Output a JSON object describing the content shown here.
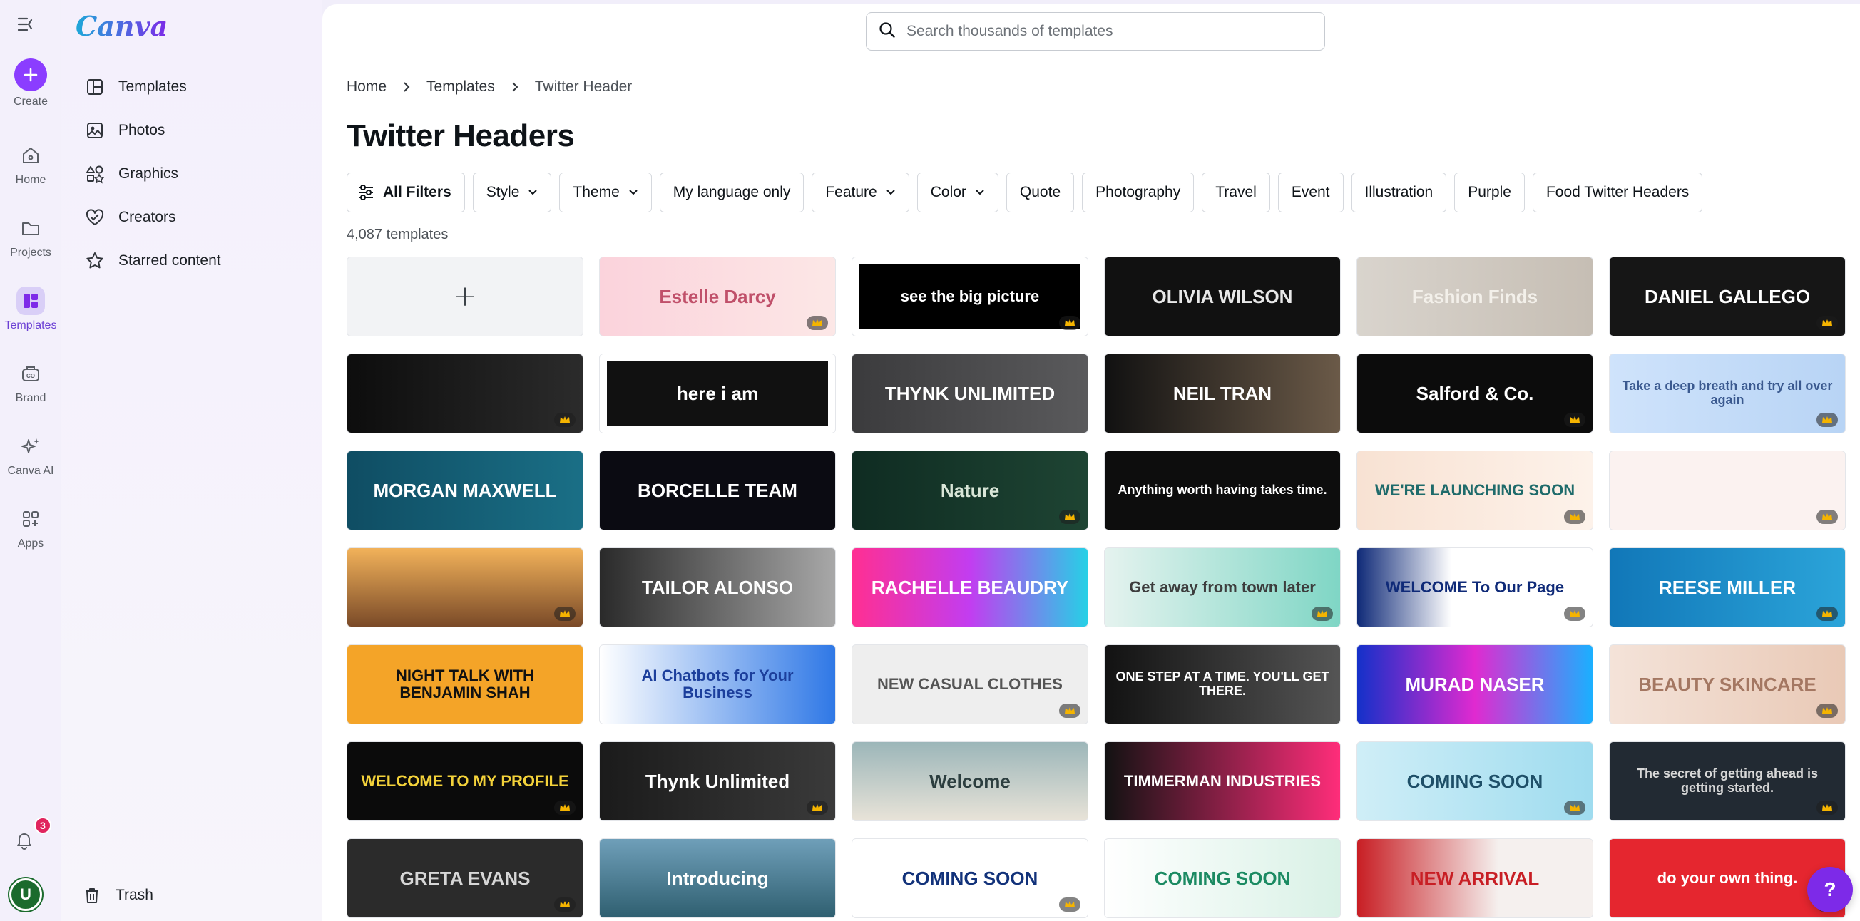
{
  "rail": {
    "items": [
      {
        "label": "Create"
      },
      {
        "label": "Home"
      },
      {
        "label": "Projects"
      },
      {
        "label": "Templates"
      },
      {
        "label": "Brand"
      },
      {
        "label": "Canva AI"
      },
      {
        "label": "Apps"
      }
    ],
    "notification_count": "3",
    "avatar_initial": "U"
  },
  "panel": {
    "logo": "Canva",
    "items": [
      {
        "label": "Templates",
        "icon": "templates-icon"
      },
      {
        "label": "Photos",
        "icon": "photos-icon"
      },
      {
        "label": "Graphics",
        "icon": "graphics-icon"
      },
      {
        "label": "Creators",
        "icon": "creators-icon"
      },
      {
        "label": "Starred content",
        "icon": "star-icon"
      }
    ],
    "trash_label": "Trash"
  },
  "search": {
    "placeholder": "Search thousands of templates"
  },
  "breadcrumb": [
    "Home",
    "Templates",
    "Twitter Header"
  ],
  "page_title": "Twitter Headers",
  "filters": [
    {
      "label": "All Filters"
    },
    {
      "label": "Style"
    },
    {
      "label": "Theme"
    },
    {
      "label": "My language only"
    },
    {
      "label": "Feature"
    },
    {
      "label": "Color"
    },
    {
      "label": "Quote"
    },
    {
      "label": "Photography"
    },
    {
      "label": "Travel"
    },
    {
      "label": "Event"
    },
    {
      "label": "Illustration"
    },
    {
      "label": "Purple"
    },
    {
      "label": "Food Twitter Headers"
    }
  ],
  "count": "4,087 templates",
  "colors": {
    "accent": "#8b3dff",
    "crown": "#f5b400",
    "badge": "#e0245e"
  },
  "templates": [
    {
      "text": "+"
    },
    {
      "text": "Estelle Darcy",
      "bg": "linear-gradient(90deg,#fbd3dc,#fce7e6)",
      "fg": "#c0506a"
    },
    {
      "text": "see the big picture",
      "bg": "#ffffff",
      "fg": "#ffffff",
      "inner": "#000"
    },
    {
      "text": "OLIVIA WILSON",
      "bg": "#111111",
      "fg": "#e8e8e8"
    },
    {
      "text": "Fashion Finds",
      "bg": "linear-gradient(90deg,#d9d4cd,#c6beb4)",
      "fg": "#f3f0ea"
    },
    {
      "text": "DANIEL GALLEGO",
      "bg": "#161616",
      "fg": "#ffffff"
    },
    {
      "text": "",
      "bg": "linear-gradient(90deg,#0d0d0d,#2b2b2b)",
      "fg": "#ddd"
    },
    {
      "text": "here i am",
      "bg": "#ffffff",
      "fg": "#ffffff",
      "inner": "#111"
    },
    {
      "text": "THYNK UNLIMITED",
      "bg": "linear-gradient(90deg,#3b3b3d,#5a5a5c)",
      "fg": "#ffffff"
    },
    {
      "text": "NEIL TRAN",
      "bg": "linear-gradient(90deg,#111,#6b5a48)",
      "fg": "#ffffff"
    },
    {
      "text": "Salford & Co.",
      "bg": "#0c0c0c",
      "fg": "#ffffff"
    },
    {
      "text": "Take a deep breath and try all over again",
      "bg": "linear-gradient(90deg,#cfe3fb,#b8d4f5)",
      "fg": "#3b5a90"
    },
    {
      "text": "MORGAN MAXWELL",
      "bg": "linear-gradient(90deg,#0f4d63,#1a6f86)",
      "fg": "#ffffff"
    },
    {
      "text": "BORCELLE TEAM",
      "bg": "#0b0b12",
      "fg": "#ffffff"
    },
    {
      "text": "Nature",
      "bg": "linear-gradient(90deg,#0f2c22,#1e4433)",
      "fg": "#d9e6d8"
    },
    {
      "text": "Anything worth having takes time.",
      "bg": "#0d0d0d",
      "fg": "#ffffff"
    },
    {
      "text": "WE'RE LAUNCHING SOON",
      "bg": "linear-gradient(90deg,#f8e2d3,#fdf2ea)",
      "fg": "#1f6b6b"
    },
    {
      "text": "",
      "bg": "#fbf2f0",
      "fg": "#b25"
    },
    {
      "text": "",
      "bg": "linear-gradient(180deg,#f2b25a,#7a4a28)",
      "fg": "#fff"
    },
    {
      "text": "TAILOR ALONSO",
      "bg": "linear-gradient(90deg,#2a2a2a,#a8a8a8)",
      "fg": "#ffffff"
    },
    {
      "text": "RACHELLE BEAUDRY",
      "bg": "linear-gradient(90deg,#ff2f92,#c23df0,#26d0e6)",
      "fg": "#ffffff"
    },
    {
      "text": "Get away from town later",
      "bg": "linear-gradient(90deg,#e5f3ef,#7fd6c5)",
      "fg": "#3d3d3d"
    },
    {
      "text": "WELCOME To Our Page",
      "bg": "linear-gradient(90deg,#0f2a78,#ffffff 40%)",
      "fg": "#0f2a78"
    },
    {
      "text": "REESE MILLER",
      "bg": "linear-gradient(90deg,#1177b8,#2ba4d9)",
      "fg": "#ffffff"
    },
    {
      "text": "NIGHT TALK WITH BENJAMIN SHAH",
      "bg": "#f4a428",
      "fg": "#111111"
    },
    {
      "text": "AI Chatbots for Your Business",
      "bg": "linear-gradient(90deg,#ffffff,#2f78e6)",
      "fg": "#1c3f9c"
    },
    {
      "text": "NEW CASUAL CLOTHES",
      "bg": "#eeeeee",
      "fg": "#555555"
    },
    {
      "text": "ONE STEP AT A TIME. YOU'LL GET THERE.",
      "bg": "linear-gradient(90deg,#121212,#555555)",
      "fg": "#ffffff"
    },
    {
      "text": "MURAD NASER",
      "bg": "linear-gradient(90deg,#1430c9,#e02ad0,#1ab0ff)",
      "fg": "#ffffff"
    },
    {
      "text": "BEAUTY SKINCARE",
      "bg": "linear-gradient(90deg,#f4e3d9,#e9c9b6)",
      "fg": "#a47762"
    },
    {
      "text": "WELCOME TO MY PROFILE",
      "bg": "#0b0b0b",
      "fg": "#f3d23a"
    },
    {
      "text": "Thynk Unlimited",
      "bg": "linear-gradient(90deg,#1b1b1b,#3a3a3a)",
      "fg": "#ffffff"
    },
    {
      "text": "Welcome",
      "bg": "linear-gradient(180deg,#9cb6b9,#e8e3d8)",
      "fg": "#2c3e3f"
    },
    {
      "text": "TIMMERMAN INDUSTRIES",
      "bg": "linear-gradient(90deg,#121212,#ff2d7a)",
      "fg": "#ffffff"
    },
    {
      "text": "COMING SOON",
      "bg": "linear-gradient(90deg,#cfeef7,#9fdcef)",
      "fg": "#1e4f68"
    },
    {
      "text": "The secret of getting ahead is getting started.",
      "bg": "#222a33",
      "fg": "#d8d8d8"
    },
    {
      "text": "GRETA EVANS",
      "bg": "#2b2b2b",
      "fg": "#d6d6d6"
    },
    {
      "text": "Introducing",
      "bg": "linear-gradient(180deg,#6f9fb9,#2f5f70)",
      "fg": "#ffffff"
    },
    {
      "text": "COMING SOON",
      "bg": "#ffffff",
      "fg": "#12327a"
    },
    {
      "text": "COMING SOON",
      "bg": "linear-gradient(90deg,#ffffff,#d9f1e6)",
      "fg": "#1b8a62"
    },
    {
      "text": "NEW ARRIVAL",
      "bg": "linear-gradient(90deg,#c81e24,#f5f0ee 60%)",
      "fg": "#c81e24"
    },
    {
      "text": "do your own thing.",
      "bg": "#e5262f",
      "fg": "#ffffff"
    }
  ],
  "help_label": "?"
}
